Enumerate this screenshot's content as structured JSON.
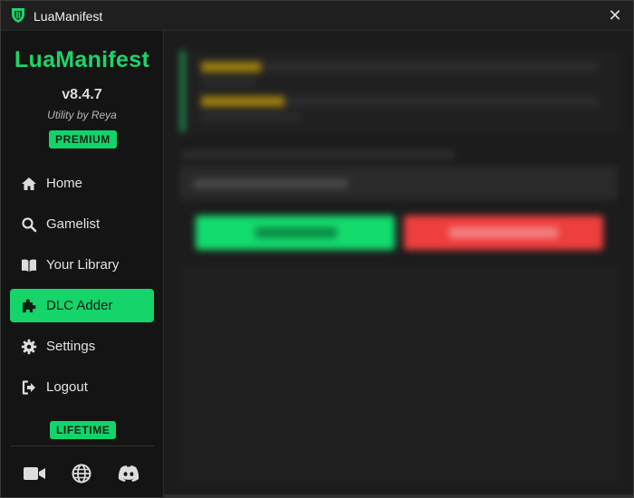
{
  "titlebar": {
    "title": "LuaManifest",
    "close_icon": "close-icon"
  },
  "sidebar": {
    "brand": "LuaManifest",
    "version": "v8.4.7",
    "tagline": "Utility by Reya",
    "plan_badge": "PREMIUM",
    "license_badge": "LIFETIME",
    "items": [
      {
        "label": "Home",
        "icon": "home-icon",
        "active": false
      },
      {
        "label": "Gamelist",
        "icon": "search-icon",
        "active": false
      },
      {
        "label": "Your Library",
        "icon": "book-icon",
        "active": false
      },
      {
        "label": "DLC Adder",
        "icon": "puzzle-icon",
        "active": true
      },
      {
        "label": "Settings",
        "icon": "gear-icon",
        "active": false
      },
      {
        "label": "Logout",
        "icon": "logout-icon",
        "active": false
      }
    ],
    "social": [
      "video-icon",
      "globe-icon",
      "discord-icon"
    ]
  },
  "colors": {
    "accent": "#14d46a",
    "danger": "#ee3f3f",
    "background": "#1c1c1c",
    "sidebar": "#141414",
    "warning": "#c8a016"
  },
  "main": {
    "blurred": true
  }
}
